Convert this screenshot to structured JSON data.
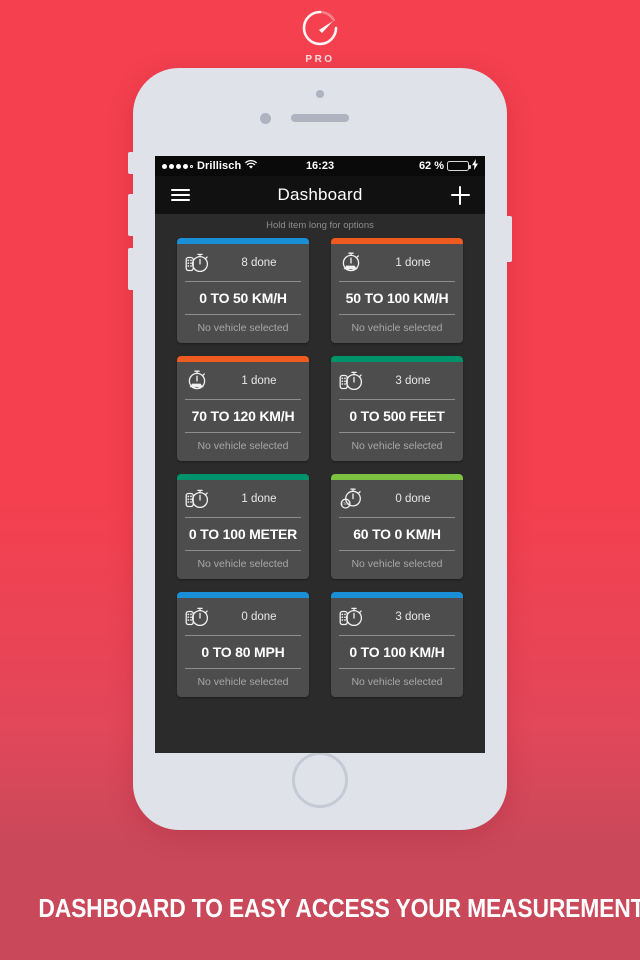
{
  "brand": {
    "logo_icon": "speedometer-gauge-icon",
    "logo_text": "PRO"
  },
  "caption": {
    "text": "DASHBOARD TO EASY ACCESS YOUR MEASUREMENT TEMPLATES"
  },
  "colors": {
    "background_top": "#f4404f",
    "background_bottom": "#c9485a",
    "phone_body": "#dfe2e9",
    "screen_bg": "#2b2b2b",
    "card_bg": "#4d4d4d",
    "nav_bg": "#111111",
    "status_bg": "#0a0a0a",
    "accent_blue": "#1a8fd8",
    "accent_orange": "#ef5a1e",
    "accent_teal": "#00936b",
    "accent_green": "#7cc140",
    "battery_green": "#4cd663"
  },
  "status_bar": {
    "signal_icon": "signal-dots-icon",
    "signal_bars_filled": 4,
    "signal_bars_total": 5,
    "carrier": "Drillisch",
    "wifi_icon": "wifi-icon",
    "time": "16:23",
    "battery_percent": "62 %",
    "battery_level": 62,
    "battery_icon": "battery-icon",
    "charging_icon": "lightning-bolt-icon"
  },
  "nav_bar": {
    "menu_icon": "hamburger-menu-icon",
    "title": "Dashboard",
    "add_icon": "plus-icon"
  },
  "hint": {
    "text": "Hold item long for options"
  },
  "cards": [
    {
      "accent": "#1a8fd8",
      "icon": "stopwatch-keypad-icon",
      "done": "8 done",
      "title": "0 TO 50 KM/H",
      "vehicle": "No vehicle selected"
    },
    {
      "accent": "#ef5a1e",
      "icon": "stopwatch-car-icon",
      "done": "1 done",
      "title": "50 TO 100 KM/H",
      "vehicle": "No vehicle selected"
    },
    {
      "accent": "#ef5a1e",
      "icon": "stopwatch-car-icon",
      "done": "1 done",
      "title": "70 TO 120 KM/H",
      "vehicle": "No vehicle selected"
    },
    {
      "accent": "#00936b",
      "icon": "stopwatch-keypad-icon",
      "done": "3 done",
      "title": "0 TO 500 FEET",
      "vehicle": "No vehicle selected"
    },
    {
      "accent": "#00936b",
      "icon": "stopwatch-keypad-icon",
      "done": "1 done",
      "title": "0 TO 100 METER",
      "vehicle": "No vehicle selected"
    },
    {
      "accent": "#7cc140",
      "icon": "stopwatch-stop-sign-icon",
      "done": "0 done",
      "title": "60 TO 0 KM/H",
      "vehicle": "No vehicle selected"
    },
    {
      "accent": "#1a8fd8",
      "icon": "stopwatch-keypad-icon",
      "done": "0 done",
      "title": "0 TO 80 MPH",
      "vehicle": "No vehicle selected"
    },
    {
      "accent": "#1a8fd8",
      "icon": "stopwatch-keypad-icon",
      "done": "3 done",
      "title": "0 TO 100 KM/H",
      "vehicle": "No vehicle selected"
    }
  ]
}
